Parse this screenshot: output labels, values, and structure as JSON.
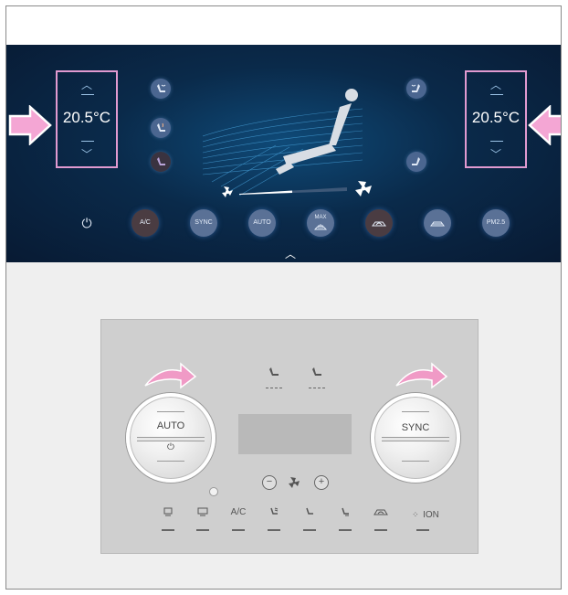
{
  "screen": {
    "left_temp": {
      "value": "20.5°C",
      "up": "︿",
      "down": "﹀"
    },
    "right_temp": {
      "value": "20.5°C",
      "up": "︿",
      "down": "﹀"
    },
    "controls": [
      {
        "id": "power",
        "label": ""
      },
      {
        "id": "ac",
        "label": "A/C"
      },
      {
        "id": "sync",
        "label": "SYNC"
      },
      {
        "id": "auto",
        "label": "AUTO"
      },
      {
        "id": "max-defrost",
        "label": "MAX"
      },
      {
        "id": "recirculation",
        "label": ""
      },
      {
        "id": "fresh-air",
        "label": ""
      },
      {
        "id": "pm25",
        "label": "PM2.5"
      }
    ],
    "colors": {
      "highlight": "#e19ad0",
      "arrow": "#f4a6d4",
      "screen_bg": "#0a2a4a"
    }
  },
  "panel": {
    "left_knob_label": "AUTO",
    "left_knob_power": "⏻",
    "right_knob_label": "SYNC",
    "fan_minus": "−",
    "fan_plus": "+",
    "ac_label": "A/C",
    "ion_label": "ION"
  }
}
